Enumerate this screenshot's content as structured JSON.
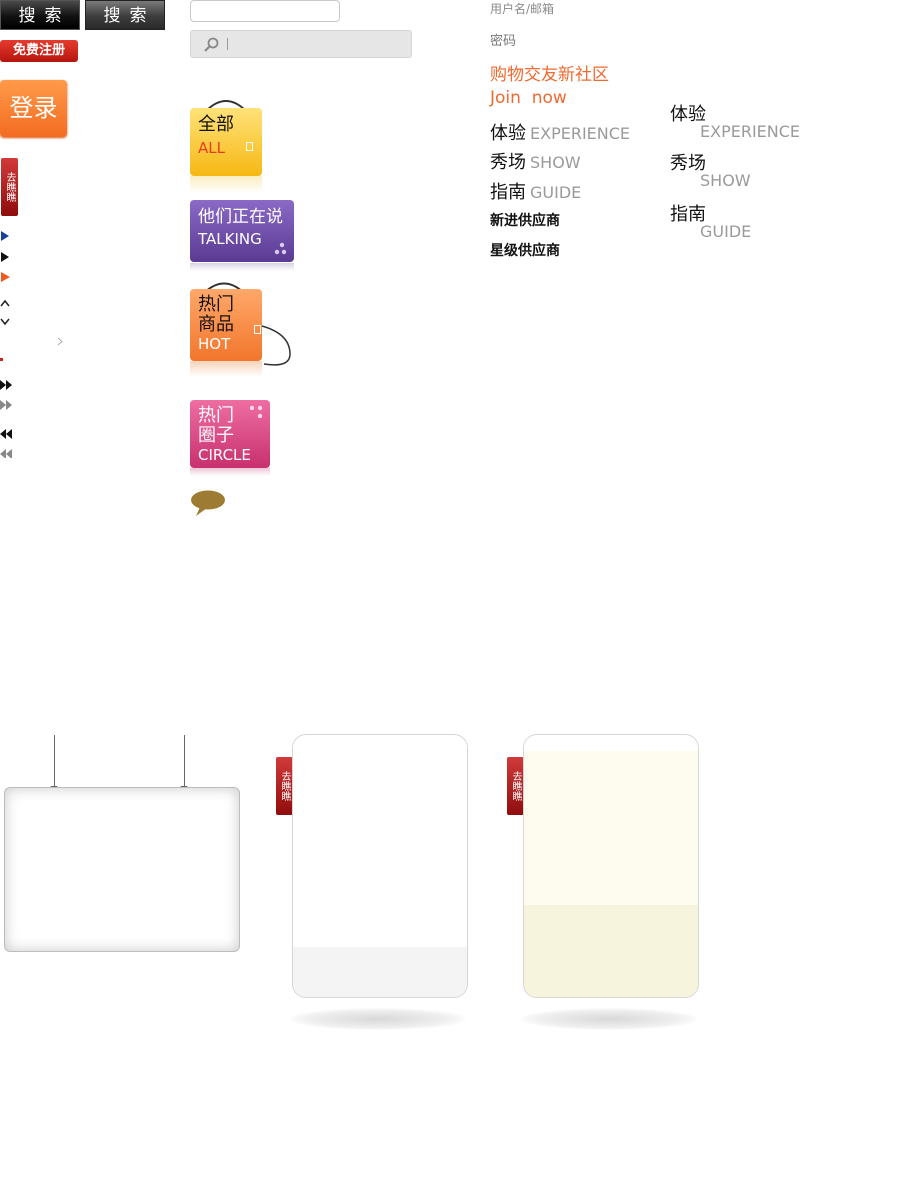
{
  "buttons": {
    "search_dark": "搜索",
    "search_gray": "搜索",
    "register": "免费注册",
    "login": "登录"
  },
  "tag": {
    "text": "去瞧瞧"
  },
  "form": {
    "username_label": "用户名/邮箱",
    "password_label": "密码"
  },
  "categories": {
    "all": {
      "cn": "全部",
      "en": "ALL"
    },
    "talking": {
      "cn": "他们正在说",
      "en": "TALKING"
    },
    "hot": {
      "cn_line1": "热门",
      "cn_line2": "商品",
      "en": "HOT"
    },
    "circle": {
      "cn_line1": "热门",
      "cn_line2": "圈子",
      "en": "CIRCLE"
    }
  },
  "promo": {
    "slogan": "购物交友新社区",
    "join": "Join  now"
  },
  "nav_a": [
    {
      "cn": "体验",
      "en": "EXPERIENCE"
    },
    {
      "cn": "秀场",
      "en": "SHOW"
    },
    {
      "cn": "指南",
      "en": "GUIDE"
    }
  ],
  "nav_b": [
    {
      "cn": "体验",
      "en": "EXPERIENCE"
    },
    {
      "cn": "秀场",
      "en": "SHOW"
    },
    {
      "cn": "指南",
      "en": "GUIDE"
    }
  ],
  "links": {
    "new_suppliers": "新进供应商",
    "star_suppliers": "星级供应商"
  },
  "colors": {
    "accent_orange": "#f06a2f",
    "tag_red": "#b01616",
    "tile_yellow": "#f6b813",
    "tile_purple": "#5b3a93",
    "tile_orange": "#f2762c",
    "tile_pink": "#c8306e"
  }
}
